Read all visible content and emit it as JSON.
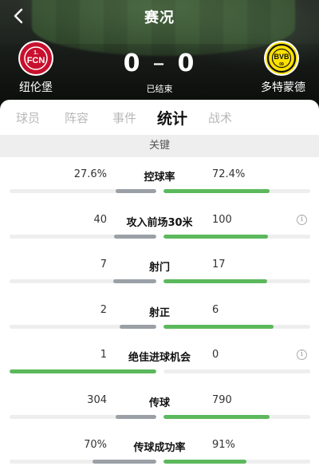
{
  "header": {
    "title": "赛况",
    "back_icon": "chevron-left-icon",
    "home_team": "纽伦堡",
    "away_team": "多特蒙德",
    "home_score": "0",
    "away_score": "0",
    "score_separator": "–",
    "status": "已结束",
    "home_logo_text": "1.FCN",
    "away_logo_text": "BVB 09"
  },
  "tabs": [
    {
      "label": "球员",
      "active": false
    },
    {
      "label": "阵容",
      "active": false
    },
    {
      "label": "事件",
      "active": false
    },
    {
      "label": "统计",
      "active": true
    },
    {
      "label": "战术",
      "active": false
    }
  ],
  "section": {
    "title": "关键"
  },
  "stats": [
    {
      "label": "控球率",
      "home": "27.6%",
      "away": "72.4%",
      "home_ratio": 0.276,
      "away_ratio": 0.724,
      "leader": "away",
      "info": false
    },
    {
      "label": "攻入前场30米",
      "home": "40",
      "away": "100",
      "home_ratio": 0.286,
      "away_ratio": 0.714,
      "leader": "away",
      "info": true
    },
    {
      "label": "射门",
      "home": "7",
      "away": "17",
      "home_ratio": 0.292,
      "away_ratio": 0.708,
      "leader": "away",
      "info": false
    },
    {
      "label": "射正",
      "home": "2",
      "away": "6",
      "home_ratio": 0.25,
      "away_ratio": 0.75,
      "leader": "away",
      "info": false
    },
    {
      "label": "绝佳进球机会",
      "home": "1",
      "away": "0",
      "home_ratio": 1.0,
      "away_ratio": 0.0,
      "leader": "home",
      "info": true
    },
    {
      "label": "传球",
      "home": "304",
      "away": "790",
      "home_ratio": 0.278,
      "away_ratio": 0.722,
      "leader": "away",
      "info": false
    },
    {
      "label": "传球成功率",
      "home": "70%",
      "away": "91%",
      "home_ratio": 0.435,
      "away_ratio": 0.565,
      "leader": "away",
      "info": false
    }
  ],
  "colors": {
    "leader": "#5cb85c",
    "trailer": "#9aa0a6",
    "track": "#eeeeee"
  },
  "info_icon": "info-circle-icon"
}
